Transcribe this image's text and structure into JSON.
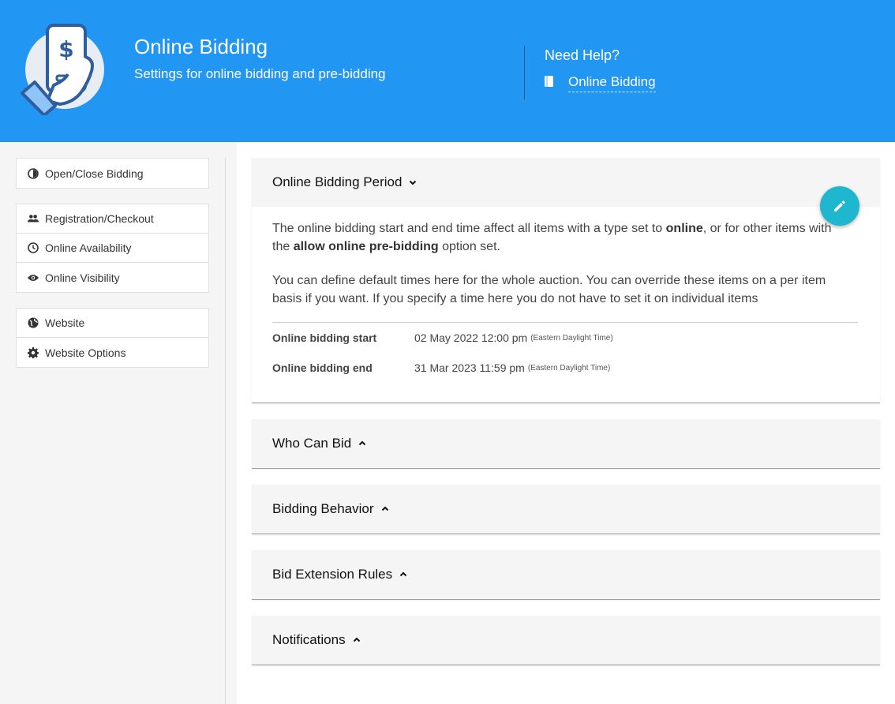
{
  "header": {
    "title": "Online Bidding",
    "subtitle": "Settings for online bidding and pre-bidding",
    "help_title": "Need Help?",
    "help_link": "Online Bidding"
  },
  "sidebar": {
    "groups": [
      [
        {
          "label": "Open/Close Bidding",
          "icon": "half-circle-icon"
        }
      ],
      [
        {
          "label": "Registration/Checkout",
          "icon": "people-icon"
        },
        {
          "label": "Online Availability",
          "icon": "clock-icon"
        },
        {
          "label": "Online Visibility",
          "icon": "eye-icon"
        }
      ],
      [
        {
          "label": "Website",
          "icon": "globe-icon"
        },
        {
          "label": "Website Options",
          "icon": "gear-icon"
        }
      ]
    ]
  },
  "main": {
    "period": {
      "title": "Online Bidding Period",
      "para1_pre": "The online bidding start and end time affect all items with a type set to ",
      "para1_b1": "online",
      "para1_mid": ", or for other items with the ",
      "para1_b2": "allow online pre-bidding",
      "para1_post": " option set.",
      "para2": "You can define default times here for the whole auction. You can override these items on a per item basis if you want. If you specify a time here you do not have to set it on individual items",
      "start_label": "Online bidding start",
      "start_value": "02 May 2022 12:00 pm",
      "start_tz": "(Eastern Daylight Time)",
      "end_label": "Online bidding end",
      "end_value": "31 Mar 2023 11:59 pm",
      "end_tz": "(Eastern Daylight Time)"
    },
    "collapsed_panels": [
      "Who Can Bid",
      "Bidding Behavior",
      "Bid Extension Rules",
      "Notifications"
    ]
  },
  "colors": {
    "header_bg": "#2196f3",
    "fab": "#1fb6cf"
  }
}
